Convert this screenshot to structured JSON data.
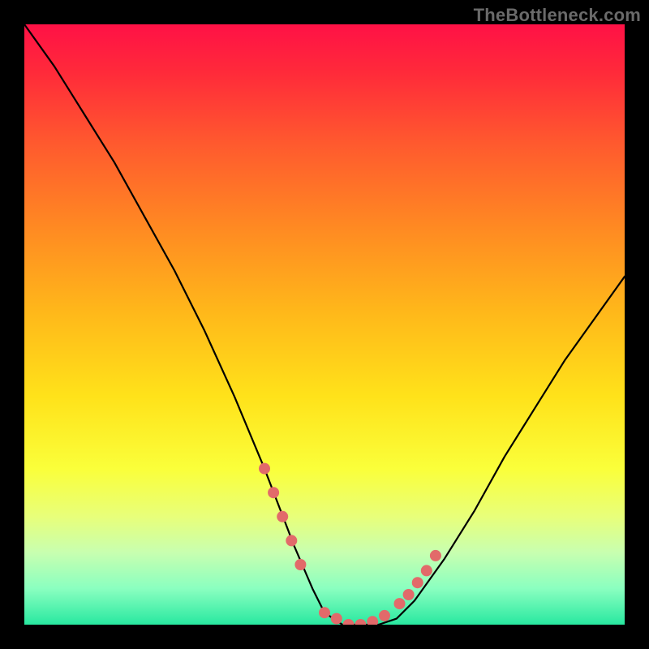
{
  "watermark": "TheBottleneck.com",
  "colors": {
    "dot": "#e26a6a",
    "line": "#000000",
    "frame": "#000000"
  },
  "chart_data": {
    "type": "line",
    "title": "",
    "xlabel": "",
    "ylabel": "",
    "xlim": [
      0,
      100
    ],
    "ylim": [
      0,
      100
    ],
    "grid": false,
    "series": [
      {
        "name": "bottleneck-curve",
        "x": [
          0,
          5,
          10,
          15,
          20,
          25,
          30,
          35,
          40,
          45,
          48,
          50,
          53,
          56,
          59,
          62,
          65,
          70,
          75,
          80,
          85,
          90,
          95,
          100
        ],
        "y": [
          100,
          93,
          85,
          77,
          68,
          59,
          49,
          38,
          26,
          13,
          6,
          2,
          0,
          0,
          0,
          1,
          4,
          11,
          19,
          28,
          36,
          44,
          51,
          58
        ]
      }
    ],
    "highlight_dots": {
      "name": "red-dots",
      "x": [
        40,
        41.5,
        43,
        44.5,
        46,
        50,
        52,
        54,
        56,
        58,
        60,
        62.5,
        64,
        65.5,
        67,
        68.5
      ],
      "y": [
        26,
        22,
        18,
        14,
        10,
        2,
        1,
        0,
        0,
        0.5,
        1.5,
        3.5,
        5,
        7,
        9,
        11.5
      ]
    }
  }
}
